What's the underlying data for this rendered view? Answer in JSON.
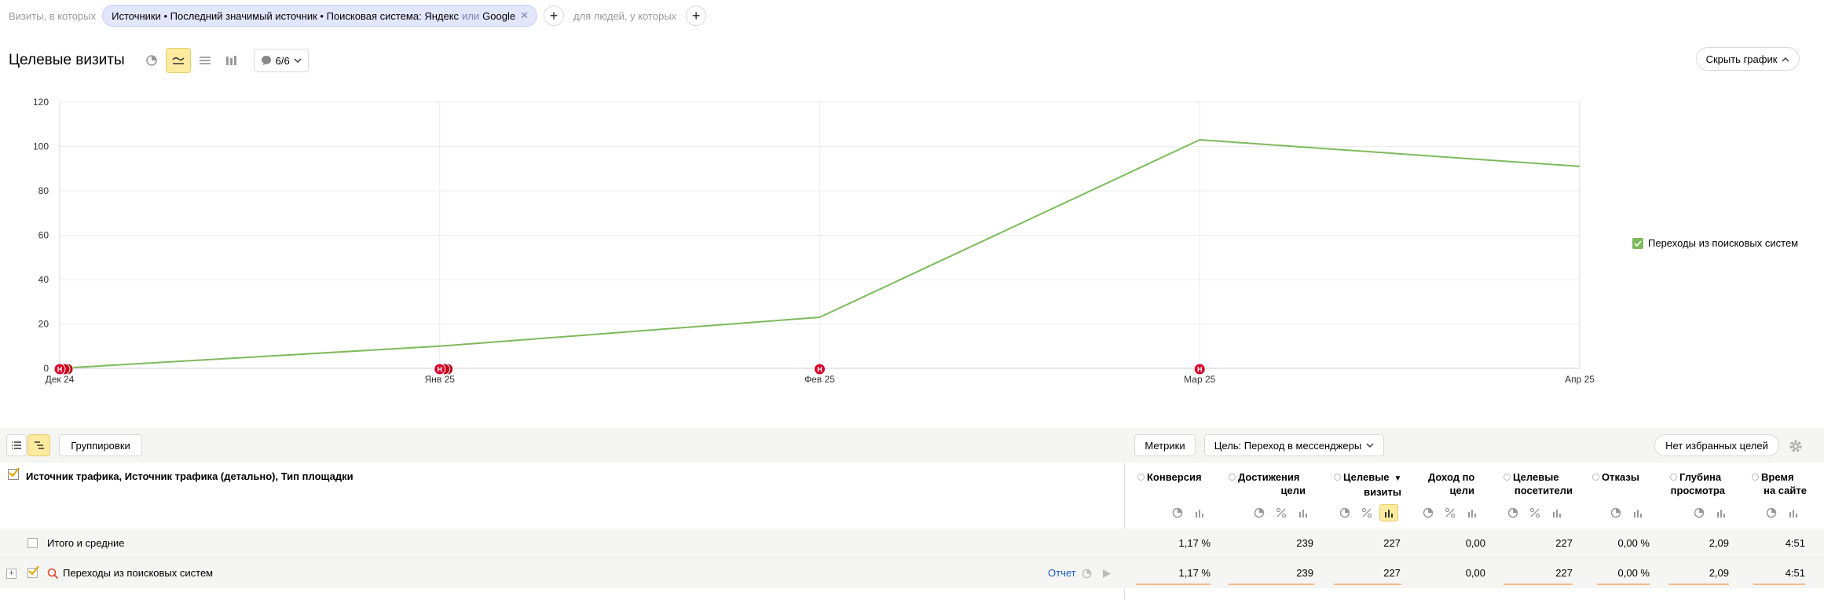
{
  "filter": {
    "prefix": "Визиты, в которых",
    "chip_main": "Источники • Последний значимый источник • Поисковая система: Яндекс",
    "chip_or": "или",
    "chip_tail": "Google",
    "people_label": "для людей, у которых"
  },
  "header": {
    "title": "Целевые визиты",
    "annotations_count": "6/6",
    "hide_chart": "Скрыть график"
  },
  "chart_data": {
    "type": "line",
    "x": [
      "Дек 24",
      "Янв 25",
      "Фев 25",
      "Мар 25",
      "Апр 25"
    ],
    "series": [
      {
        "name": "Переходы из поисковых систем",
        "values": [
          0,
          10,
          23,
          103,
          91
        ],
        "color": "#7cba5b"
      }
    ],
    "ylim": [
      0,
      120
    ],
    "yticks": [
      "0",
      "20",
      "40",
      "60",
      "80",
      "100",
      "120"
    ],
    "grid": true,
    "legend": "right",
    "annotation_markers": [
      {
        "x": "Дек 24",
        "label": "Н"
      },
      {
        "x": "Янв 25",
        "label": "Н"
      },
      {
        "x": "Фев 25",
        "label": "Н"
      },
      {
        "x": "Мар 25",
        "label": "Н"
      }
    ]
  },
  "toolbar": {
    "groupings": "Группировки",
    "metrics": "Метрики",
    "goal_select": "Цель: Переход в мессенджеры",
    "favorite_goals": "Нет избранных целей"
  },
  "table": {
    "dimensions_title": "Источник трафика, Источник трафика (детально), Тип площадки",
    "columns": [
      {
        "line1": "Конверсия",
        "line2": "",
        "radio": true,
        "sorted": false
      },
      {
        "line1": "Достижения",
        "line2": "цели",
        "radio": true,
        "sorted": false
      },
      {
        "line1": "Целевые",
        "line2": "визиты",
        "radio": true,
        "sorted": true
      },
      {
        "line1": "Доход по",
        "line2": "цели",
        "radio": false,
        "sorted": false
      },
      {
        "line1": "Целевые",
        "line2": "посетители",
        "radio": true,
        "sorted": false
      },
      {
        "line1": "Отказы",
        "line2": "",
        "radio": true,
        "sorted": false
      },
      {
        "line1": "Глубина",
        "line2": "просмотра",
        "radio": true,
        "sorted": false
      },
      {
        "line1": "Время",
        "line2": "на сайте",
        "radio": true,
        "sorted": false
      }
    ],
    "sort_arrow": "▼",
    "rows": [
      {
        "label": "Итого и средние",
        "values": [
          "1,17 %",
          "239",
          "227",
          "0,00",
          "227",
          "0,00 %",
          "2,09",
          "4:51"
        ]
      },
      {
        "label": "Переходы из поисковых систем",
        "report": "Отчет",
        "values": [
          "1,17 %",
          "239",
          "227",
          "0,00",
          "227",
          "0,00 %",
          "2,09",
          "4:51"
        ]
      }
    ]
  }
}
